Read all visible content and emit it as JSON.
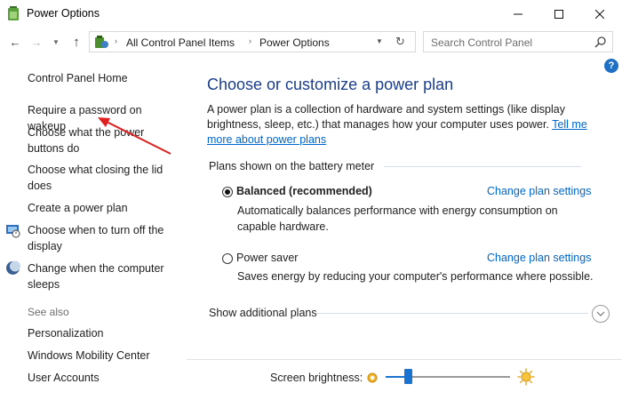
{
  "window": {
    "title": "Power Options"
  },
  "address": {
    "crumbs": [
      "All Control Panel Items",
      "Power Options"
    ]
  },
  "search": {
    "placeholder": "Search Control Panel"
  },
  "help": {
    "glyph": "?"
  },
  "sidebar": {
    "home": "Control Panel Home",
    "links": [
      "Require a password on wakeup",
      "Choose what the power buttons do",
      "Choose what closing the lid does",
      "Create a power plan",
      "Choose when to turn off the display",
      "Change when the computer sleeps"
    ],
    "see_also_label": "See also",
    "see_also": [
      "Personalization",
      "Windows Mobility Center",
      "User Accounts"
    ]
  },
  "main": {
    "title": "Choose or customize a power plan",
    "intro_text": "A power plan is a collection of hardware and system settings (like display brightness, sleep, etc.) that manages how your computer uses power.",
    "intro_link": "Tell me more about power plans",
    "plans_header": "Plans shown on the battery meter",
    "plans": [
      {
        "name": "Balanced (recommended)",
        "selected": true,
        "link": "Change plan settings",
        "description": "Automatically balances performance with energy consumption on capable hardware."
      },
      {
        "name": "Power saver",
        "selected": false,
        "link": "Change plan settings",
        "description": "Saves energy by reducing your computer's performance where possible."
      }
    ],
    "show_additional": "Show additional plans"
  },
  "brightness": {
    "label": "Screen brightness:",
    "level": 0.18
  },
  "colors": {
    "accent": "#1a73d0",
    "link": "#0066cc",
    "title": "#1a3e8c",
    "annotation_arrow": "#e02020"
  }
}
